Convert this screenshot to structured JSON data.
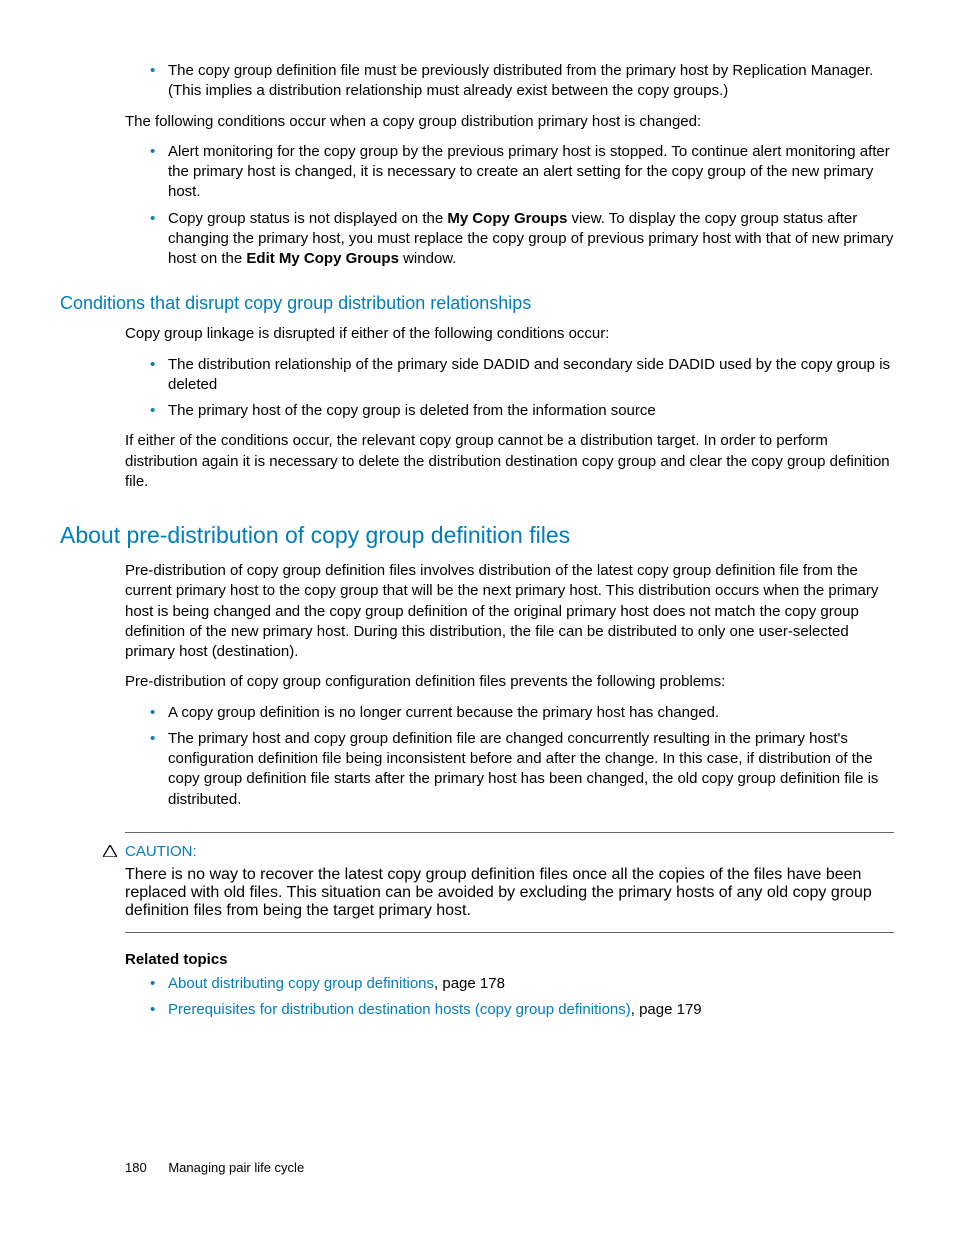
{
  "intro_list": [
    "The copy group definition file must be previously distributed from the primary host by Replication Manager. (This implies a distribution relationship must already exist between the copy groups.)"
  ],
  "intro_para": "The following conditions occur when a copy group distribution primary host is changed:",
  "cond_change": [
    {
      "text": "Alert monitoring for the copy group by the previous primary host is stopped. To continue alert monitoring after the primary host is changed, it is necessary to create an alert setting for the copy group of the new primary host."
    },
    {
      "pre": "Copy group status is not displayed on the ",
      "bold1": "My Copy Groups",
      "mid": " view. To display the copy group status after changing the primary host, you must replace the copy group of previous primary host with that of new primary host on the ",
      "bold2": "Edit My Copy Groups",
      "post": " window."
    }
  ],
  "disrupt": {
    "heading": "Conditions that disrupt copy group distribution relationships",
    "intro": "Copy group linkage is disrupted if either of the following conditions occur:",
    "items": [
      "The distribution relationship of the primary side DADID and secondary side DADID used by the copy group is deleted",
      "The primary host of the copy group is deleted from the information source"
    ],
    "outro": "If either of the conditions occur, the relevant copy group cannot be a distribution target. In order to perform distribution again it is necessary to delete the distribution destination copy group and clear the copy group definition file."
  },
  "predist": {
    "heading": "About pre-distribution of copy group definition files",
    "p1": "Pre-distribution of copy group definition files involves distribution of the latest copy group definition file from the current primary host to the copy group that will be the next primary host. This distribution occurs when the primary host is being changed and the copy group definition of the original primary host does not match the copy group definition of the new primary host. During this distribution, the file can be distributed to only one user-selected primary host (destination).",
    "p2": "Pre-distribution of copy group configuration definition files prevents the following problems:",
    "items": [
      "A copy group definition is no longer current because the primary host has changed.",
      "The primary host and copy group definition file are changed concurrently resulting in the primary host's configuration definition file being inconsistent before and after the change. In this case, if distribution of the copy group definition file starts after the primary host has been changed, the old copy group definition file is distributed."
    ]
  },
  "caution": {
    "label": "CAUTION:",
    "text": "There is no way to recover the latest copy group definition files once all the copies of the files have been replaced with old files. This situation can be avoided by excluding the primary hosts of any old copy group definition files from being the target primary host."
  },
  "related": {
    "heading": "Related topics",
    "items": [
      {
        "link": "About distributing copy group definitions",
        "rest": ", page 178"
      },
      {
        "link": "Prerequisites for distribution destination hosts (copy group definitions)",
        "rest": ", page 179"
      }
    ]
  },
  "footer": {
    "page": "180",
    "title": "Managing pair life cycle"
  }
}
